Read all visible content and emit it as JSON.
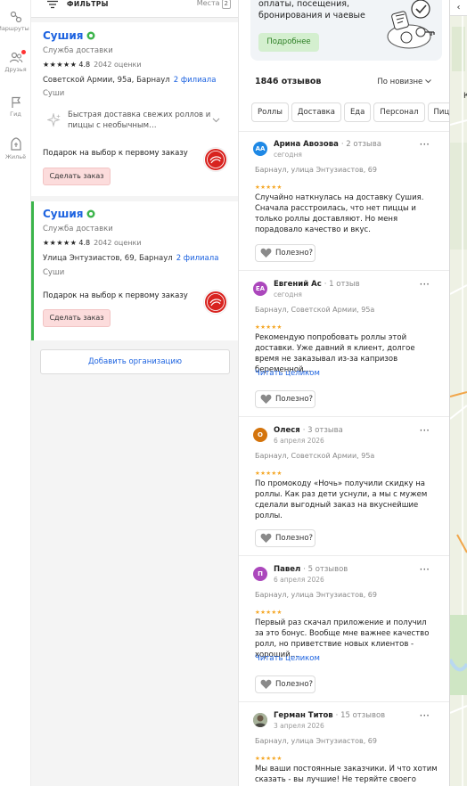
{
  "rail": {
    "items": [
      {
        "label": "Маршруты",
        "icon": "routes-icon"
      },
      {
        "label": "Друзья",
        "icon": "friends-icon"
      },
      {
        "label": "Гид",
        "icon": "guide-flag-icon"
      },
      {
        "label": "Жильё",
        "icon": "housing-icon"
      }
    ]
  },
  "filters": {
    "label": "ФИЛЬТРЫ",
    "places_label": "Места",
    "places_count": "2"
  },
  "results": [
    {
      "name": "Сушия",
      "category": "Служба доставки",
      "stars": "★★★★★",
      "rating": "4.8",
      "ratings_count": "2042 оценки",
      "address": "Советской Армии, 95а, Барнаул",
      "branches": "2 филиала",
      "rubric": "Суши",
      "feature": "Быстрая доставка свежих роллов и пиццы с необычным…",
      "gift": "Подарок на выбор к первому заказу",
      "order_button": "Сделать заказ"
    },
    {
      "name": "Сушия",
      "category": "Служба доставки",
      "stars": "★★★★★",
      "rating": "4.8",
      "ratings_count": "2042 оценки",
      "address": "Улица Энтузиастов, 69, Барнаул",
      "branches": "2 филиала",
      "rubric": "Суши",
      "gift": "Подарок на выбор к первому заказу",
      "order_button": "Сделать заказ"
    }
  ],
  "add_org_label": "Добавить организацию",
  "banner": {
    "text": "оплаты, посещения, бронирования и чаевые",
    "button": "Подробнее"
  },
  "reviews_header": {
    "count": "1846 отзывов",
    "sort": "По новизне"
  },
  "review_tabs": [
    "Роллы",
    "Доставка",
    "Еда",
    "Персонал",
    "Пицца"
  ],
  "reviews": [
    {
      "author": "Арина Авозова",
      "author_reviews": "2 отзыва",
      "date": "сегодня",
      "initials": "АА",
      "avatar_color": "#1e88e5",
      "address": "Барнаул, улица Энтузиастов, 69",
      "stars": "★★★★★",
      "text": "Случайно наткнулась на доставку Сушия. Сначала расстроилась, что нет пиццы и только роллы доставляют. Но меня порадовало качество и вкус.",
      "read_all": "",
      "helpful": "Полезно?"
    },
    {
      "author": "Евгений Ас",
      "author_reviews": "1 отзыв",
      "date": "сегодня",
      "initials": "ЕА",
      "avatar_color": "#ab47bc",
      "address": "Барнаул, Советской Армии, 95а",
      "stars": "★★★★★",
      "text": "Рекомендую попробовать роллы этой доставки. Уже давний я клиент, долгое время не заказывал из-за капризов беременной…",
      "read_all": "Читать целиком",
      "helpful": "Полезно?"
    },
    {
      "author": "Олеся",
      "author_reviews": "3 отзыва",
      "date": "6 апреля 2026",
      "initials": "О",
      "avatar_color": "#d4740c",
      "address": "Барнаул, Советской Армии, 95а",
      "stars": "★★★★★",
      "text": "По промокоду «Ночь» получили скидку на роллы. Как раз дети уснули, а мы с мужем сделали выгодный заказ на вкуснейшие роллы.",
      "read_all": "",
      "helpful": "Полезно?"
    },
    {
      "author": "Павел",
      "author_reviews": "5 отзывов",
      "date": "6 апреля 2026",
      "initials": "П",
      "avatar_color": "#ab47bc",
      "address": "Барнаул, улица Энтузиастов, 69",
      "stars": "★★★★★",
      "text": "Первый раз скачал приложение и получил за это бонус. Вообще мне важнее качество ролл, но приветствие новых клиентов - хороший…",
      "read_all": "Читать целиком",
      "helpful": "Полезно?"
    },
    {
      "author": "Герман Титов",
      "author_reviews": "15 отзывов",
      "date": "3 апреля 2026",
      "initials": "",
      "avatar_color": "#8d8d7a",
      "address": "Барнаул, улица Энтузиастов, 69",
      "stars": "★★★★★",
      "text": "Мы ваши постоянные заказчики. И что хотим сказать - вы лучшие! Не теряйте своего",
      "read_all": "",
      "helpful": ""
    }
  ],
  "map": {
    "back_icon": "chevron-left-icon",
    "label": "К"
  },
  "colors": {
    "link": "#1d63e0",
    "active_border": "#3cb44b",
    "order_button_bg": "#fcdcdc",
    "banner_button_bg": "#d4efcf",
    "review_stars": "#f5a623"
  }
}
